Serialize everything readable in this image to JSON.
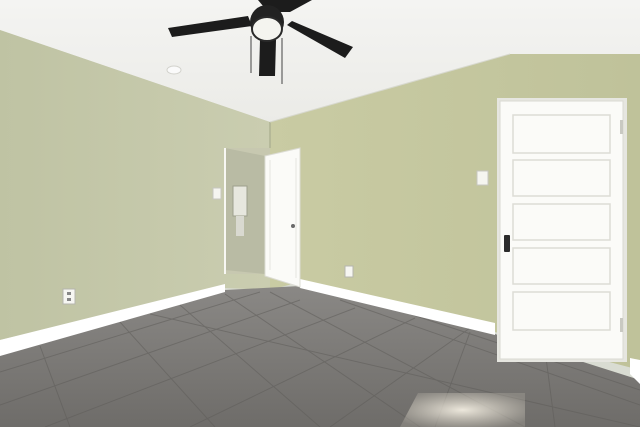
{
  "scene": {
    "subject": "empty-bedroom-interior",
    "colors": {
      "wall": "#c6c9a5",
      "wall_shadow": "#b3b896",
      "ceiling": "#f2f2ef",
      "floor": "#7d7b78",
      "grout": "#5f5d5a",
      "trim": "#ffffff",
      "door": "#fbfbf8",
      "fan": "#1c1c1c"
    },
    "objects": [
      "ceiling-fan",
      "smoke-detector",
      "open-door",
      "closed-panel-door",
      "light-switch",
      "electrical-outlet",
      "tile-floor",
      "baseboard"
    ]
  }
}
